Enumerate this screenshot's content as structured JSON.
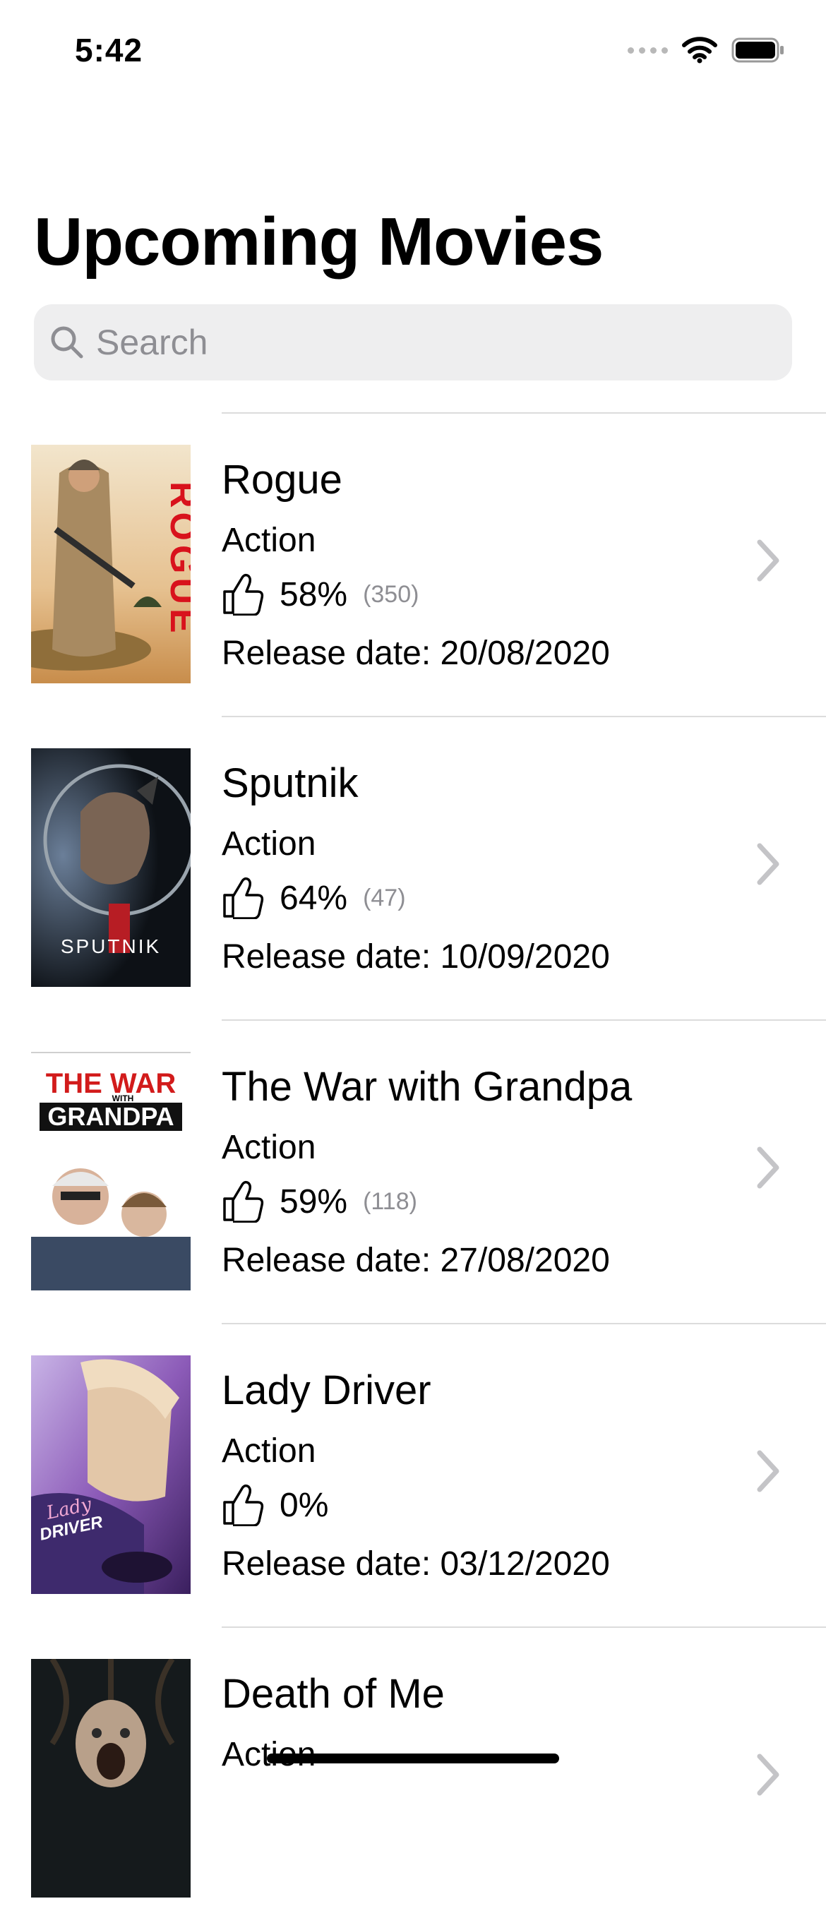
{
  "status_bar": {
    "time": "5:42"
  },
  "page": {
    "title": "Upcoming Movies"
  },
  "search": {
    "placeholder": "Search"
  },
  "movies": [
    {
      "title": "Rogue",
      "genre": "Action",
      "rating": "58%",
      "votes": "(350)",
      "release_label": "Release date:",
      "release_date": "20/08/2020",
      "poster_text": "ROGUE"
    },
    {
      "title": "Sputnik",
      "genre": "Action",
      "rating": "64%",
      "votes": "(47)",
      "release_label": "Release date:",
      "release_date": "10/09/2020",
      "poster_text": "SPUTNIK"
    },
    {
      "title": "The War with Grandpa",
      "genre": "Action",
      "rating": "59%",
      "votes": "(118)",
      "release_label": "Release date:",
      "release_date": "27/08/2020",
      "poster_text_1": "THE WAR",
      "poster_text_2": "WITH",
      "poster_text_3": "GRANDPA"
    },
    {
      "title": "Lady Driver",
      "genre": "Action",
      "rating": "0%",
      "votes": "",
      "release_label": "Release date:",
      "release_date": "03/12/2020",
      "poster_text_1": "Lady",
      "poster_text_2": "DRIVER"
    },
    {
      "title": "Death of Me",
      "genre": "Action"
    }
  ],
  "colors": {
    "chevron": "#c4c4c7",
    "separator": "#dcdcdc",
    "search_bg": "#eeeeef",
    "placeholder": "#8e8e93"
  }
}
